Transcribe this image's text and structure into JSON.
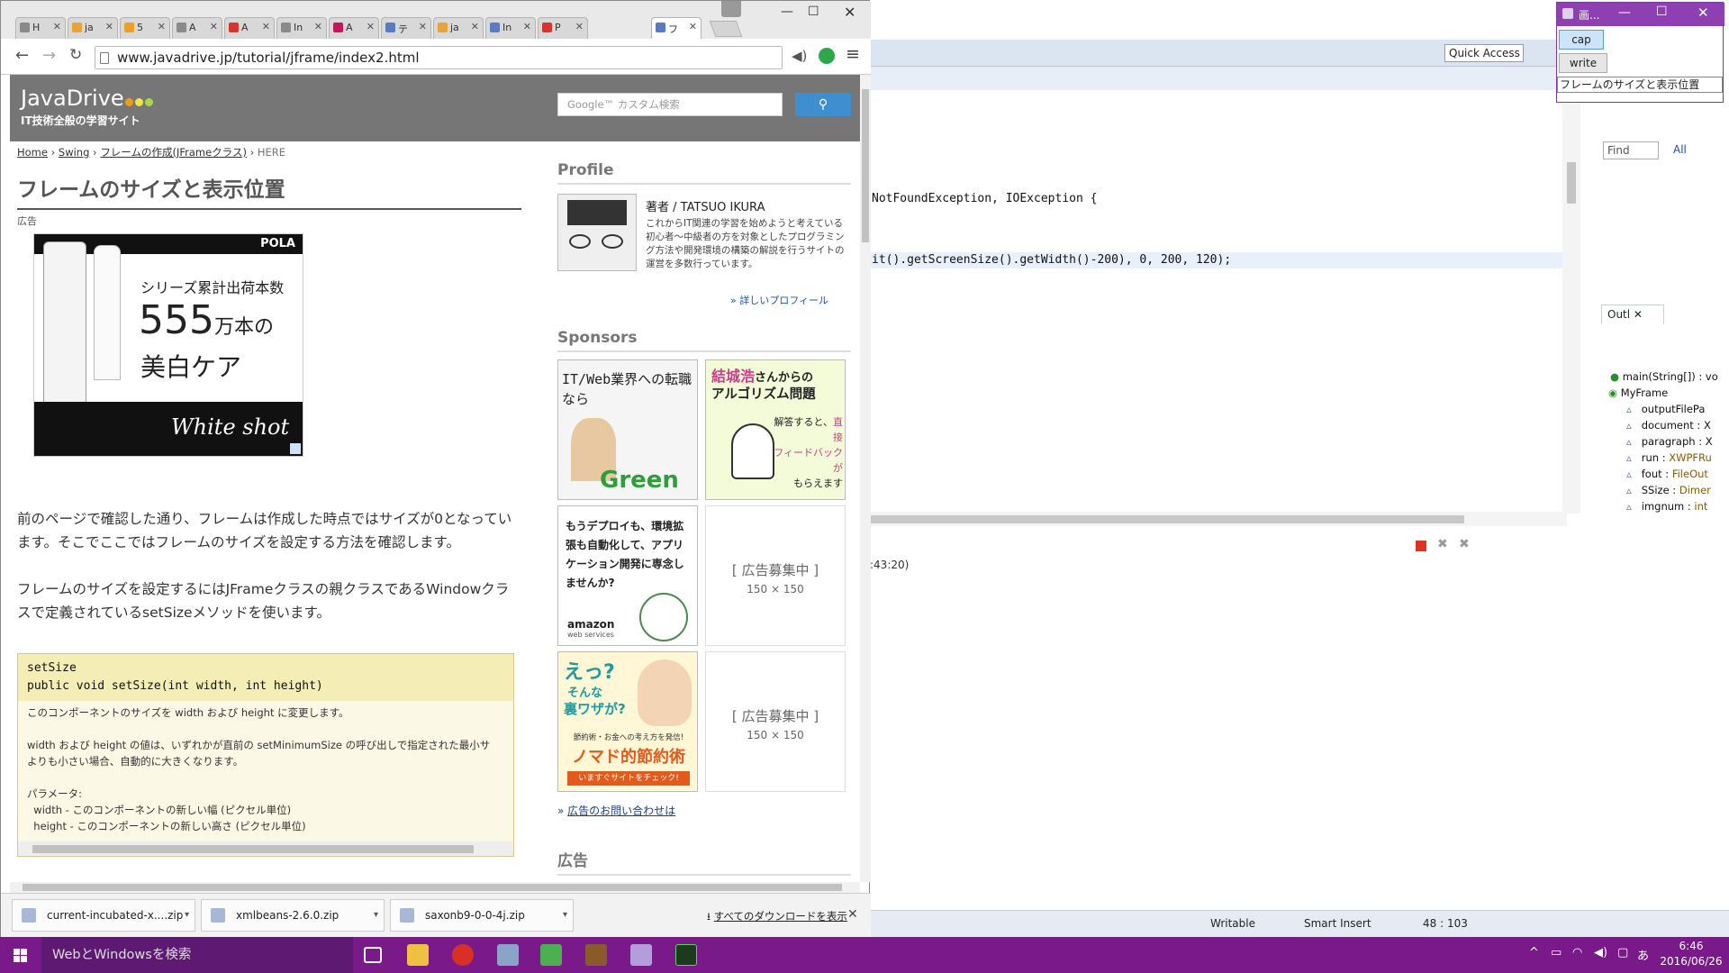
{
  "eclipse": {
    "quick_access": "Quick Access",
    "code_line_1": "NotFoundException, IOException {",
    "code_line_2": "it().getScreenSize().getWidth()-200), 0, 200, 120);",
    "find_placeholder": "Find",
    "find_all": "All",
    "console_label": ":43:20)",
    "outline": {
      "tab": "Outl",
      "items": [
        {
          "label": "main(String[]) : vo",
          "type": ""
        },
        {
          "label": "MyFrame",
          "type": ""
        },
        {
          "label": "outputFilePa",
          "type": ""
        },
        {
          "label": "document : X",
          "type": ""
        },
        {
          "label": "paragraph : X",
          "type": ""
        },
        {
          "label": "run : ",
          "type": "XWPFRu"
        },
        {
          "label": "fout : ",
          "type": "FileOut"
        },
        {
          "label": "SSize : ",
          "type": "Dimer"
        },
        {
          "label": "imgnum : ",
          "type": "int"
        }
      ]
    },
    "status": {
      "writable": "Writable",
      "insert": "Smart Insert",
      "position": "48 : 103"
    }
  },
  "mini_window": {
    "title": "画...",
    "cap_button": "cap",
    "write_button": "write",
    "input_value": "フレームのサイズと表示位置"
  },
  "chrome": {
    "tabs": [
      {
        "label": "H",
        "color": "#8a8a8a"
      },
      {
        "label": "ja",
        "color": "#e8a33a"
      },
      {
        "label": "5",
        "color": "#f0a020"
      },
      {
        "label": "A",
        "color": "#8a8a8a"
      },
      {
        "label": "A",
        "color": "#d9342b"
      },
      {
        "label": "In",
        "color": "#8a8a8a"
      },
      {
        "label": "A",
        "color": "#c2185b"
      },
      {
        "label": "テ",
        "color": "#5a7bbf"
      },
      {
        "label": "ja",
        "color": "#e8a33a"
      },
      {
        "label": "In",
        "color": "#5a7bbf"
      },
      {
        "label": "P",
        "color": "#d9342b"
      },
      {
        "label": "フ",
        "color": "#5a7bbf"
      }
    ],
    "url": "www.javadrive.jp/tutorial/jframe/index2.html",
    "downloads": [
      {
        "name": "current-incubated-x....zip"
      },
      {
        "name": "xmlbeans-2.6.0.zip"
      },
      {
        "name": "saxonb9-0-0-4j.zip"
      }
    ],
    "show_all_downloads": "すべてのダウンロードを表示"
  },
  "page": {
    "site_title": "JavaDrive",
    "site_subtitle": "IT技術全般の学習サイト",
    "search_placeholder": "Google™ カスタム検索",
    "breadcrumb": {
      "home": "Home",
      "swing": "Swing",
      "jframe": "フレームの作成(JFrameクラス)",
      "here": "HERE"
    },
    "title": "フレームのサイズと表示位置",
    "ad_label": "広告",
    "pola_ad": {
      "brand": "POLA",
      "line1": "シリーズ累計出荷本数",
      "line2a": "555",
      "line2b": "万本の",
      "line3": "美白ケア",
      "product": "White shot"
    },
    "para1": "前のページで確認した通り、フレームは作成した時点ではサイズが0となっています。そこでここではフレームのサイズを設定する方法を確認します。",
    "para2": "フレームのサイズを設定するにはJFrameクラスの親クラスであるWindowクラスで定義されているsetSizeメソッドを使います。",
    "api": {
      "name": "setSize",
      "signature": "public void setSize(int width, int height)",
      "body": "このコンポーネントのサイズを width および height に変更します。\n\nwidth および height の値は、いずれかが直前の setMinimumSize の呼び出しで指定された最小サ\nよりも小さい場合、自動的に大きくなります。\n\nパラメータ:\n  width - このコンポーネントの新しい幅 (ピクセル単位)\n  height - このコンポーネントの新しい高さ (ピクセル単位)"
    },
    "sidebar": {
      "profile_heading": "Profile",
      "author": "著者 / TATSUO IKURA",
      "profile_desc": "これからIT関連の学習を始めようと考えている初心者〜中級者の方を対象としたプログラミング方法や開発環境の構築の解説を行うサイトの運営を多数行っています。",
      "profile_more": "» 詳しいプロフィール",
      "sponsors_heading": "Sponsors",
      "ad_green": {
        "text": "IT/Web業界への転職なら",
        "brand": "Green"
      },
      "ad_algo": {
        "line1": "結城浩",
        "line2": "さんからの",
        "line3": "アルゴリズム問題",
        "sub1": "解答すると、",
        "sub2": "直接",
        "sub3": "フィードバックが",
        "sub4": "もらえます"
      },
      "ad_aws": {
        "text": "もうデプロイも、環境拡張も自動化して、アプリケーション開発に専念しませんか?",
        "brand": "amazon",
        "brand_sub": "web services"
      },
      "ad_recruit": {
        "text": "[ 広告募集中 ]",
        "size": "150 × 150"
      },
      "ad_setsuyaku": {
        "line1": "えっ?",
        "line2": "そんな",
        "line3": "裏ワザが?",
        "sub": "節約術・お金への考え方を発信!",
        "main": "ノマド的節約術",
        "cta": "いますぐサイトをチェック!"
      },
      "ad_recruit2": {
        "text": "[ 広告募集中 ]",
        "size": "150 × 150"
      },
      "contact": "広告のお問い合わせは",
      "koukoku_heading": "広告"
    }
  },
  "taskbar": {
    "search": "WebとWindowsを検索",
    "time": "6:46",
    "date": "2016/06/26",
    "ime": "あ"
  },
  "colors": {
    "taskbar": "#7a1a8a",
    "header": "#767676",
    "accent_blue": "#3e8ed0"
  }
}
